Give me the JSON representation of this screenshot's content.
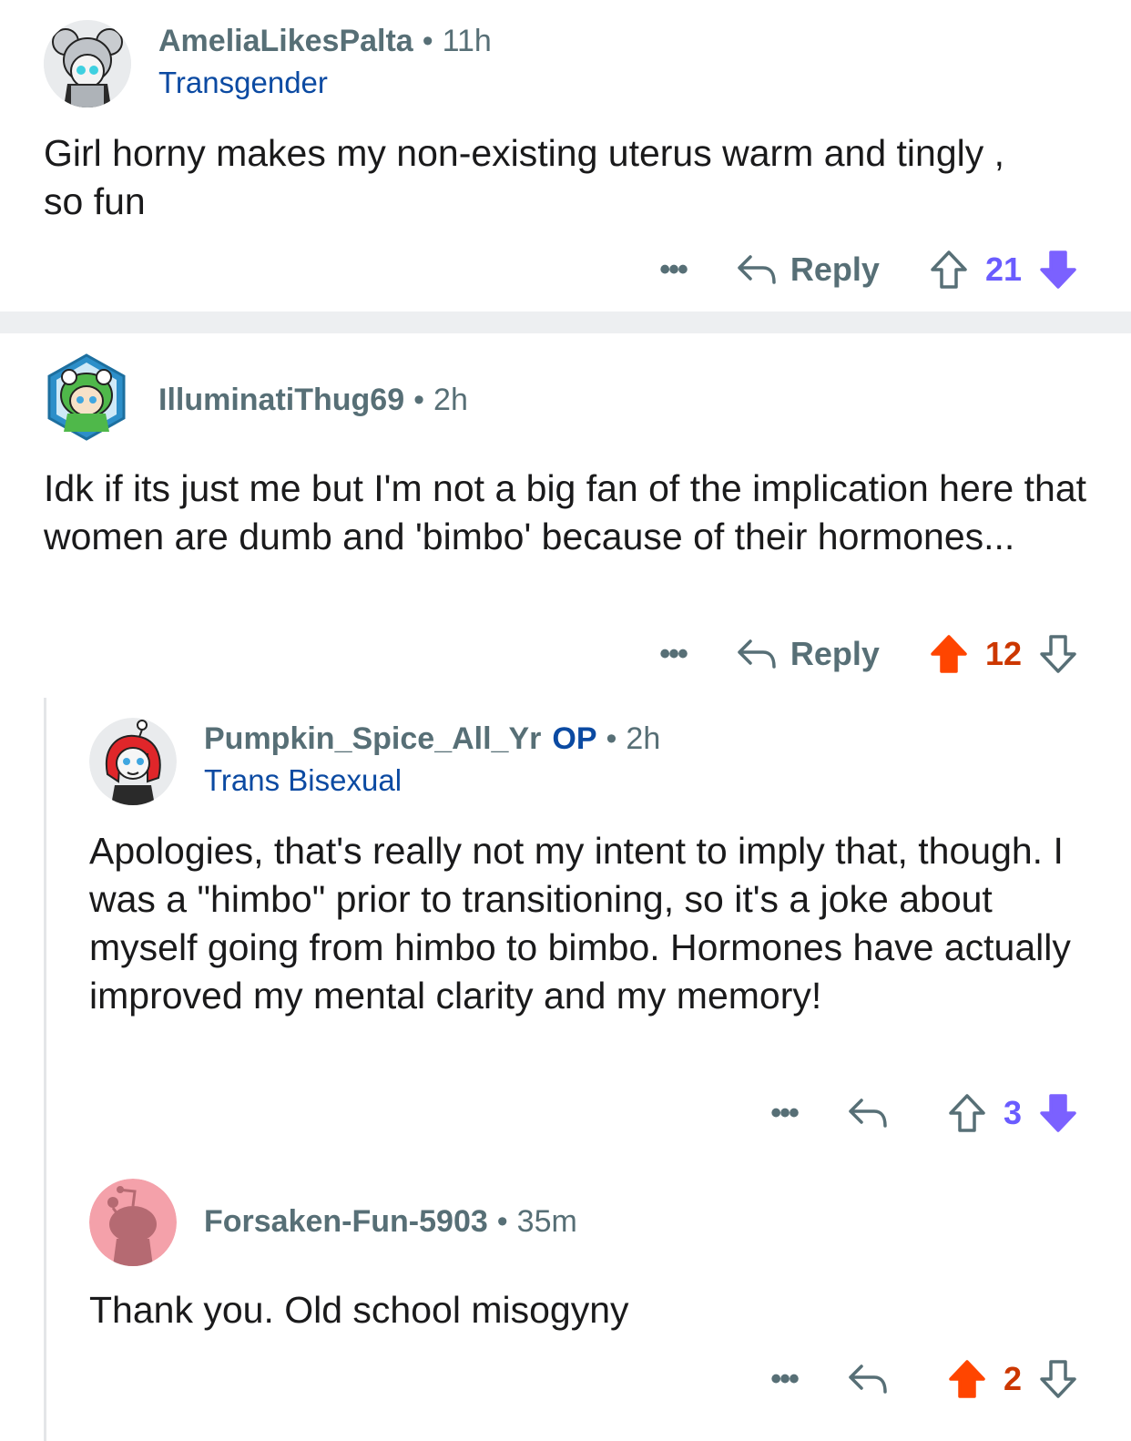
{
  "comments": [
    {
      "username": "AmeliaLikesPalta",
      "time": "11h",
      "flair": "Transgender",
      "body": "Girl horny makes my non-existing uterus warm and tingly  , so fun",
      "more": "•••",
      "reply_label": "Reply",
      "score": "21",
      "vote_state": "downvoted"
    },
    {
      "username": "IlluminatiThug69",
      "time": "2h",
      "body": "Idk if its just me but I'm not a big fan of the implication here that women are dumb and 'bimbo' because of their hormones...",
      "more": "•••",
      "reply_label": "Reply",
      "score": "12",
      "vote_state": "upvoted"
    },
    {
      "username": "Pumpkin_Spice_All_Yr",
      "op_badge": "OP",
      "time": "2h",
      "flair": "Trans Bisexual",
      "body": "Apologies, that's really not my intent to imply that, though. I was a \"himbo\" prior to transitioning, so it's a joke about myself going from himbo to bimbo. Hormones have actually improved my mental clarity and my memory!",
      "more": "•••",
      "score": "3",
      "vote_state": "downvoted"
    },
    {
      "username": "Forsaken-Fun-5903",
      "time": "35m",
      "body": "Thank you. Old school misogyny",
      "more": "•••",
      "score": "2",
      "vote_state": "upvoted"
    }
  ],
  "colors": {
    "upvote": "#ff4500",
    "upvote_count": "#cc3700",
    "downvote": "#7b61ff",
    "downvote_count": "#6a5cff",
    "meta": "#576f76",
    "flair": "#0b4aa2"
  },
  "icons": [
    "koala-avatar-icon",
    "frog-hood-avatar-icon",
    "redhead-avatar-icon",
    "snoo-avatar-icon",
    "reply-arrow-icon",
    "upvote-arrow-icon",
    "downvote-arrow-icon"
  ]
}
